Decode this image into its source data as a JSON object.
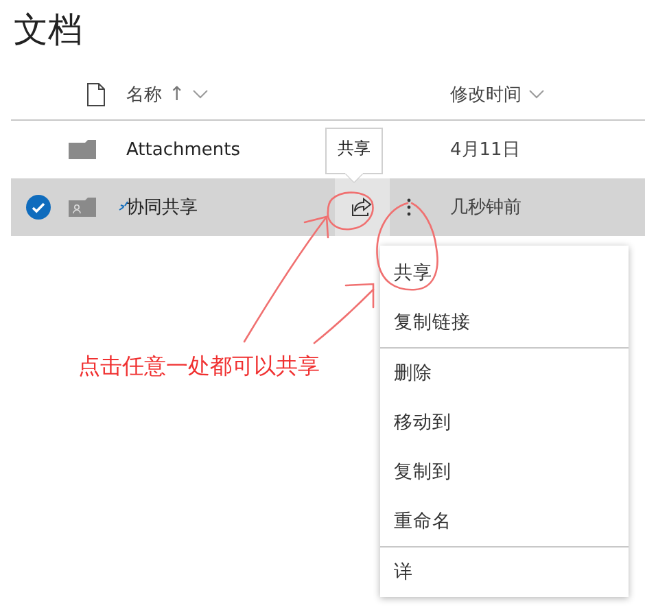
{
  "title": "文档",
  "columns": [
    {
      "label": "名称",
      "sort_arrow": "↑"
    },
    {
      "label": "修改时间"
    }
  ],
  "rows": [
    {
      "kind": "folder",
      "name": "Attachments",
      "modified": "4月11日",
      "selected": false,
      "new": false
    },
    {
      "kind": "shared-folder",
      "name": "协同共享",
      "modified": "几秒钟前",
      "selected": true,
      "new": true
    }
  ],
  "tooltip": {
    "text": "共享"
  },
  "menu": [
    {
      "label": "共享",
      "divider_before": false
    },
    {
      "label": "复制链接",
      "divider_before": false
    },
    {
      "label": "删除",
      "divider_before": true
    },
    {
      "label": "移动到",
      "divider_before": false
    },
    {
      "label": "复制到",
      "divider_before": false
    },
    {
      "label": "重命名",
      "divider_before": false
    },
    {
      "label": "详",
      "divider_before": true
    }
  ],
  "annotation": {
    "text": "点击任意一处都可以共享"
  }
}
